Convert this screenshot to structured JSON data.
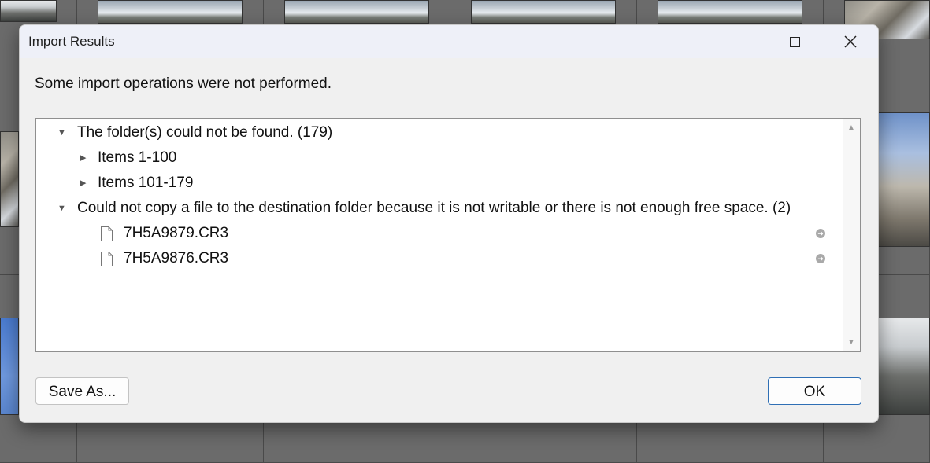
{
  "dialog": {
    "title": "Import Results",
    "message": "Some import operations were not performed.",
    "tree": [
      {
        "label": "The folder(s) could not be found. (179)",
        "expanded": true,
        "icon": "triangle-down-icon"
      },
      {
        "label": "Items 1-100",
        "expanded": false,
        "icon": "triangle-right-icon"
      },
      {
        "label": "Items 101-179",
        "expanded": false,
        "icon": "triangle-right-icon"
      },
      {
        "label": "Could not copy a file to the destination folder because it is not writable or there is not enough free space. (2)",
        "expanded": true,
        "icon": "triangle-down-icon"
      },
      {
        "label": "7H5A9879.CR3",
        "icon": "file-icon"
      },
      {
        "label": "7H5A9876.CR3",
        "icon": "file-icon"
      }
    ],
    "buttons": {
      "save_as": "Save As...",
      "ok": "OK"
    }
  },
  "colors": {
    "ok_border": "#2f6fb5",
    "titlebar": "#eef0f8",
    "dialog_bg": "#f0f0f0"
  }
}
